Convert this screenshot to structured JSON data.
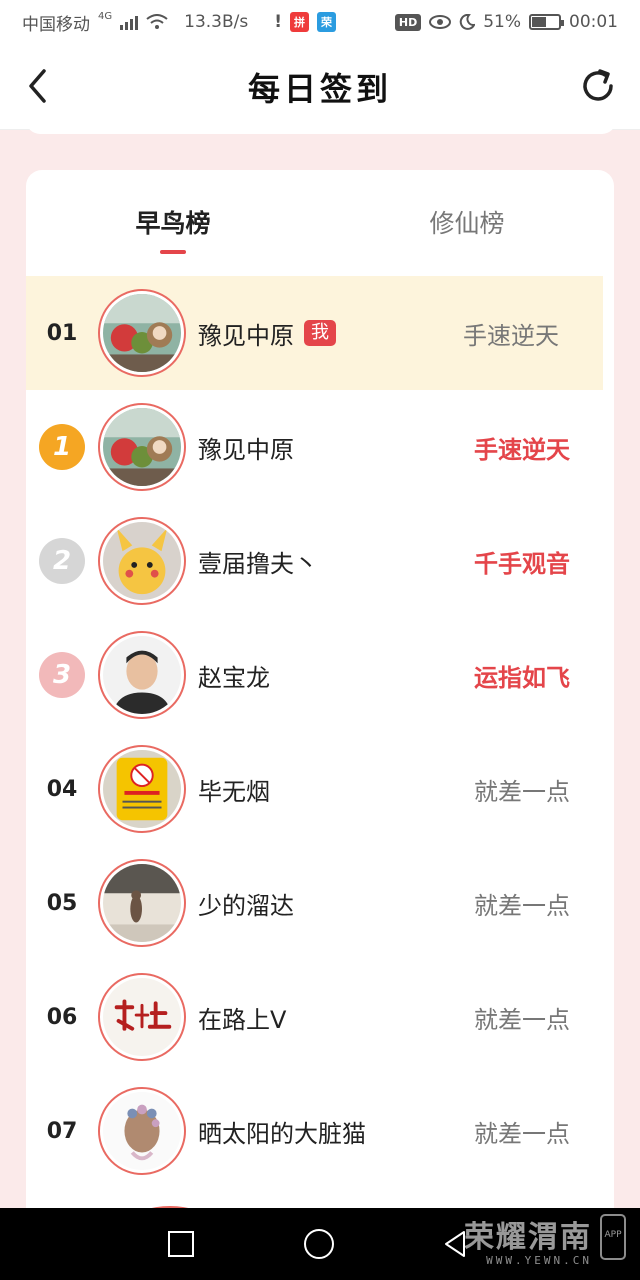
{
  "status_bar": {
    "carrier": "中国移动",
    "network": "4G",
    "speed": "13.3B/s",
    "hd_label": "HD",
    "battery_percent": "51%",
    "time": "00:01",
    "icons": [
      "signal-icon",
      "wifi-icon",
      "alert-icon",
      "app-notification-icon",
      "eye-comfort-icon",
      "moon-icon",
      "battery-icon"
    ]
  },
  "header": {
    "title": "每日签到",
    "back_icon": "chevron-left-icon",
    "refresh_icon": "refresh-icon"
  },
  "tabs": [
    {
      "label": "早鸟榜",
      "active": true
    },
    {
      "label": "修仙榜",
      "active": false
    }
  ],
  "my_entry": {
    "rank": "01",
    "name": "豫见中原",
    "me_label": "我",
    "title": "手速逆天"
  },
  "rankings": [
    {
      "rank": "1",
      "medal": "gold",
      "name": "豫见中原",
      "title": "手速逆天"
    },
    {
      "rank": "2",
      "medal": "silver",
      "name": "壹届撸夫丶",
      "title": "千手观音"
    },
    {
      "rank": "3",
      "medal": "bronze",
      "name": "赵宝龙",
      "title": "运指如飞"
    },
    {
      "rank": "04",
      "name": "毕无烟",
      "title": "就差一点"
    },
    {
      "rank": "05",
      "name": "少的溜达",
      "title": "就差一点"
    },
    {
      "rank": "06",
      "name": "在路上V",
      "title": "就差一点"
    },
    {
      "rank": "07",
      "name": "晒太阳的大脏猫",
      "title": "就差一点"
    }
  ],
  "colors": {
    "accent": "#e4454a",
    "mine_bg": "#fdf4dc",
    "page_bg": "#fbeaea"
  },
  "watermark": {
    "brand": "荣耀渭南",
    "site": "WWW.YEWN.CN",
    "app": "APP"
  }
}
